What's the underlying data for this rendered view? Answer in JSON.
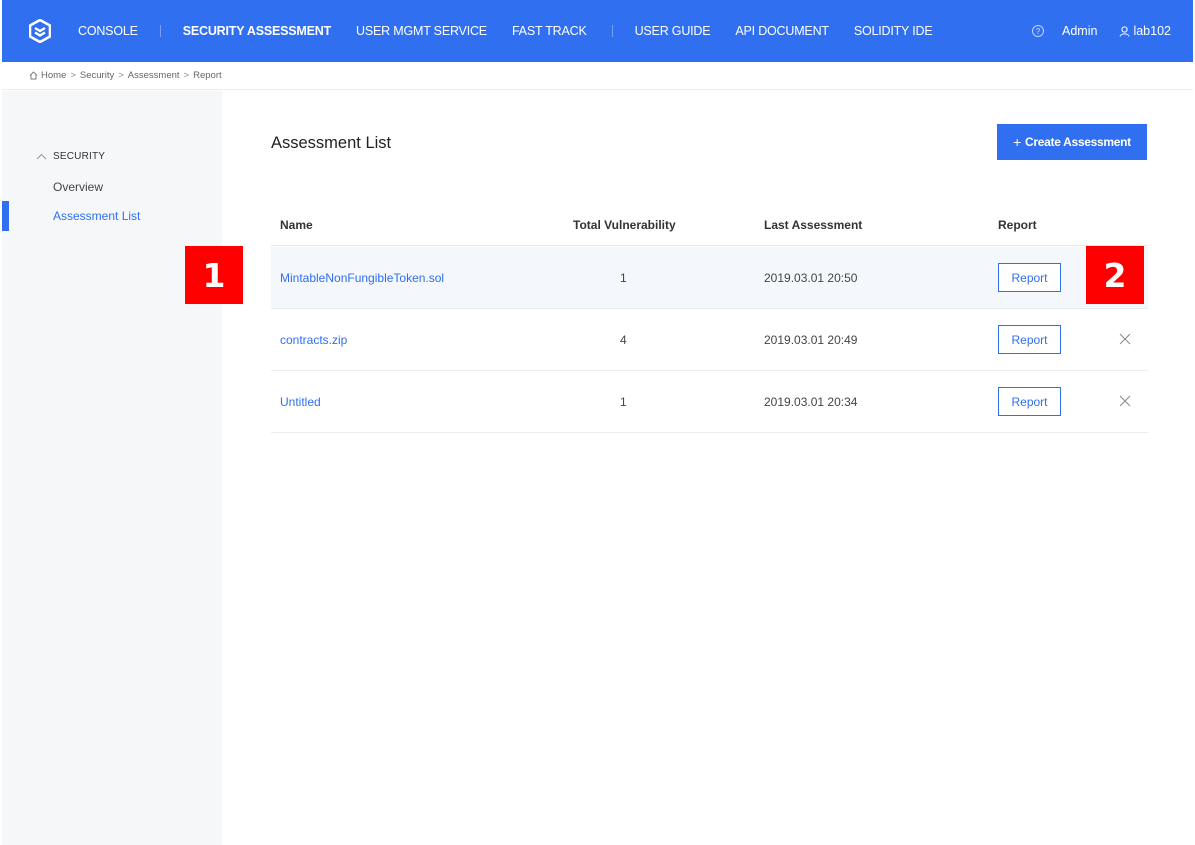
{
  "nav": {
    "items": [
      {
        "label": "CONSOLE"
      },
      {
        "label": "SECURITY ASSESSMENT"
      },
      {
        "label": "USER MGMT SERVICE"
      },
      {
        "label": "FAST TRACK"
      },
      {
        "label": "USER GUIDE"
      },
      {
        "label": "API DOCUMENT"
      },
      {
        "label": "SOLIDITY IDE"
      }
    ],
    "admin_label": "Admin",
    "user_label": "lab102",
    "help_icon": "question-circle-icon",
    "user_icon": "user-icon",
    "accent_color": "#2f6ff0"
  },
  "breadcrumb": [
    "Home",
    "Security",
    "Assessment",
    "Report"
  ],
  "sidebar": {
    "group_label": "SECURITY",
    "items": [
      {
        "label": "Overview"
      },
      {
        "label": "Assessment List"
      }
    ]
  },
  "main": {
    "title": "Assessment List",
    "create_button": "Create Assessment",
    "columns": [
      "Name",
      "Total Vulnerability",
      "Last Assessment",
      "Report"
    ],
    "rows": [
      {
        "name": "MintableNonFungibleToken.sol",
        "vulnerability": "1",
        "date": "2019.03.01 20:50",
        "report": "Report"
      },
      {
        "name": "contracts.zip",
        "vulnerability": "4",
        "date": "2019.03.01 20:49",
        "report": "Report"
      },
      {
        "name": "Untitled",
        "vulnerability": "1",
        "date": "2019.03.01 20:34",
        "report": "Report"
      }
    ]
  },
  "markers": [
    "1",
    "2"
  ]
}
